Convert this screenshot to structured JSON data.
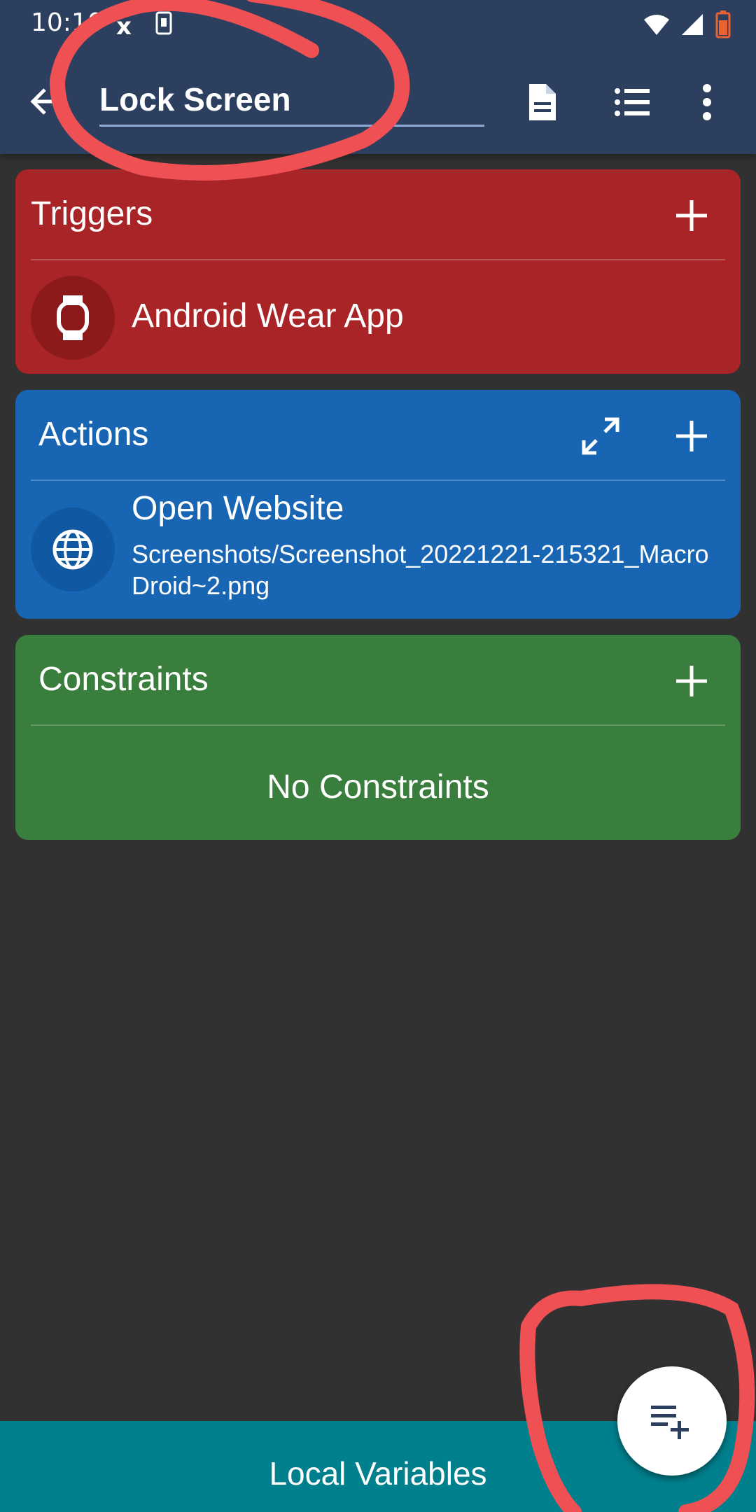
{
  "status_bar": {
    "time": "10:10",
    "misc_icon_text": "x"
  },
  "app_bar": {
    "title": "Lock Screen",
    "icons": [
      "back-arrow-icon",
      "document-icon",
      "list-icon",
      "more-vert-icon"
    ]
  },
  "triggers": {
    "header": "Triggers",
    "items": [
      {
        "label": "Android Wear App",
        "icon": "watch-icon"
      }
    ],
    "color": "#a82426"
  },
  "actions": {
    "header": "Actions",
    "items": [
      {
        "label": "Open Website",
        "detail": "Screenshots/Screenshot_20221221-215321_MacroDroid~2.png",
        "icon": "globe-icon"
      }
    ],
    "color": "#1866b3"
  },
  "constraints": {
    "header": "Constraints",
    "empty_text": "No Constraints",
    "color": "#3a7e3d"
  },
  "bottom_bar": {
    "label": "Local Variables",
    "color": "#00808d"
  },
  "fab": {
    "icon": "playlist-add-icon"
  }
}
